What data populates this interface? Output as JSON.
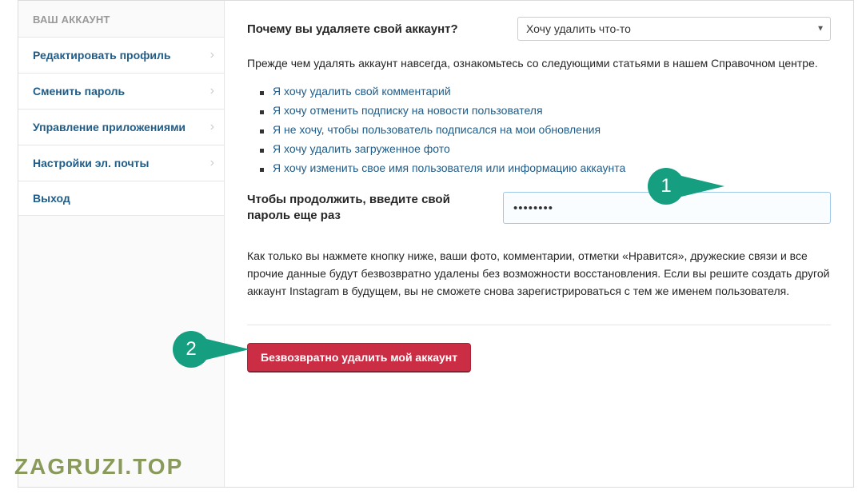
{
  "sidebar": {
    "header": "ВАШ АККАУНТ",
    "items": [
      {
        "label": "Редактировать профиль",
        "has_chevron": true
      },
      {
        "label": "Сменить пароль",
        "has_chevron": true
      },
      {
        "label": "Управление приложениями",
        "has_chevron": true
      },
      {
        "label": "Настройки эл. почты",
        "has_chevron": true
      },
      {
        "label": "Выход",
        "has_chevron": false
      }
    ]
  },
  "main": {
    "reason_question": "Почему вы удаляете свой аккаунт?",
    "reason_selected": "Хочу удалить что-то",
    "intro": "Прежде чем удалять аккаунт навсегда, ознакомьтесь со следующими статьями в нашем Справочном центре.",
    "help_links": [
      "Я хочу удалить свой комментарий",
      "Я хочу отменить подписку на новости пользователя",
      "Я не хочу, чтобы пользователь подписался на мои обновления",
      "Я хочу удалить загруженное фото",
      "Я хочу изменить свое имя пользователя или информацию аккаунта"
    ],
    "password_label": "Чтобы продолжить, введите свой пароль еще раз",
    "password_value": "••••••••",
    "warning": "Как только вы нажмете кнопку ниже, ваши фото, комментарии, отметки «Нравится», дружеские связи и все прочие данные будут безвозвратно удалены без возможности восстановления. Если вы решите создать другой аккаунт Instagram в будущем, вы не сможете снова зарегистрироваться с тем же именем пользователя.",
    "delete_button": "Безвозвратно удалить мой аккаунт"
  },
  "annotations": {
    "callout1": "1",
    "callout2": "2"
  },
  "watermark": "ZAGRUZI.TOP"
}
